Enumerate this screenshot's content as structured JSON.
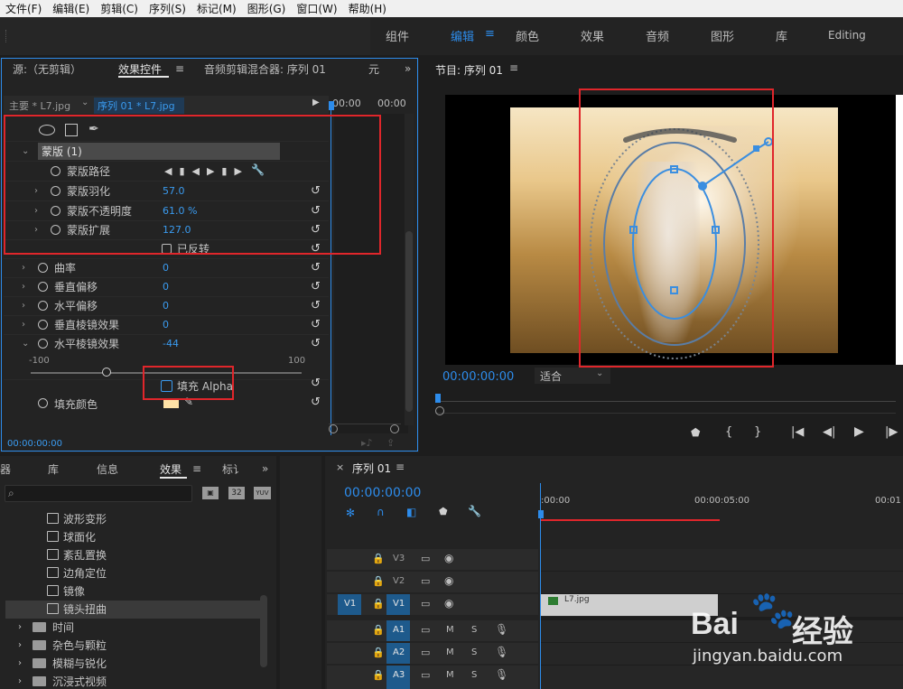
{
  "menu": [
    "文件(F)",
    "编辑(E)",
    "剪辑(C)",
    "序列(S)",
    "标记(M)",
    "图形(G)",
    "窗口(W)",
    "帮助(H)"
  ],
  "workspaces": [
    "组件",
    "编辑",
    "颜色",
    "效果",
    "音频",
    "图形",
    "库",
    "Editing"
  ],
  "active_workspace": "编辑",
  "left_panel": {
    "tabs": [
      "源:（无剪辑）",
      "效果控件",
      "音频剪辑混合器: 序列 01",
      "元"
    ],
    "active_tab": "效果控件",
    "master_clip": "主要 * L7.jpg",
    "sequence_clip": "序列 01 * L7.jpg",
    "ruler": [
      "00:00",
      "00:00"
    ],
    "mask_name": "蒙版 (1)",
    "mask_path_label": "蒙版路径",
    "params": [
      {
        "label": "蒙版羽化",
        "value": "57.0"
      },
      {
        "label": "蒙版不透明度",
        "value": "61.0 %"
      },
      {
        "label": "蒙版扩展",
        "value": "127.0"
      }
    ],
    "inverted_label": "已反转",
    "effect_params": [
      {
        "label": "曲率",
        "value": "0"
      },
      {
        "label": "垂直偏移",
        "value": "0"
      },
      {
        "label": "水平偏移",
        "value": "0"
      },
      {
        "label": "垂直棱镜效果",
        "value": "0"
      },
      {
        "label": "水平棱镜效果",
        "value": "-44"
      }
    ],
    "slider_min": "-100",
    "slider_max": "100",
    "fill_alpha_label": "填充 Alpha",
    "fill_color_label": "填充颜色",
    "timecode": "00:00:00:00"
  },
  "program": {
    "title": "节目: 序列 01",
    "timecode": "00:00:00:00",
    "fit": "适合"
  },
  "effects_panel": {
    "tabs": [
      "器",
      "库",
      "信息",
      "效果",
      "标讠"
    ],
    "active_tab": "效果",
    "items": [
      "波形变形",
      "球面化",
      "紊乱置换",
      "边角定位",
      "镜像",
      "镜头扭曲"
    ],
    "selected": "镜头扭曲",
    "folders": [
      "时间",
      "杂色与颗粒",
      "模糊与锐化",
      "沉浸式视频"
    ],
    "badges": [
      "32",
      "YUV"
    ]
  },
  "timeline": {
    "title": "序列 01",
    "timecode": "00:00:00:00",
    "ruler": [
      ":00:00",
      "00:00:05:00",
      "00:01"
    ],
    "video_tracks": [
      "V3",
      "V2",
      "V1"
    ],
    "audio_tracks": [
      "A1",
      "A2",
      "A3"
    ],
    "source_v": "V1",
    "clip_name": "L7.jpg",
    "mute": "M",
    "solo": "S"
  },
  "watermark": {
    "brand": "Bai",
    "brand2": "经验",
    "url": "jingyan.baidu.com"
  },
  "colors": {
    "accent": "#2d8ceb",
    "annotation": "#e0262b",
    "fill_swatch": "#ffe2a6"
  }
}
